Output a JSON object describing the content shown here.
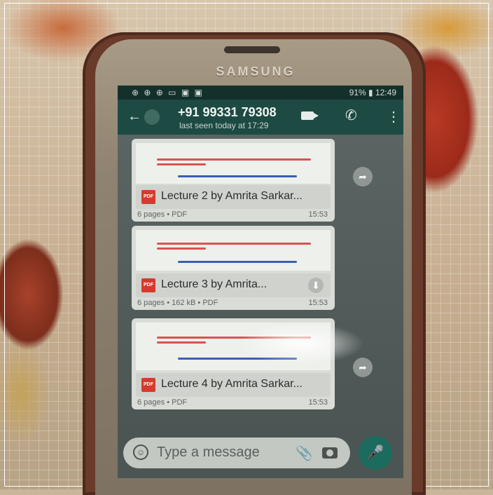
{
  "phone": {
    "brand": "SAMSUNG"
  },
  "status_bar": {
    "left_icons": "⊕ ⊕ ⊕ ▭ ▣ ▣",
    "right": "91% ▮ 12:49"
  },
  "header": {
    "contact": "+91 99331 79308",
    "last_seen": "last seen today at 17:29"
  },
  "messages": [
    {
      "title": "Lecture 2 by Amrita Sarkar...",
      "meta": "6 pages • PDF",
      "time": "15:53",
      "pdf_label": "PDF"
    },
    {
      "title": "Lecture 3 by Amrita...",
      "meta": "6 pages • 162 kB • PDF",
      "time": "15:53",
      "pdf_label": "PDF"
    },
    {
      "title": "Lecture 4 by Amrita Sarkar...",
      "meta": "6 pages • PDF",
      "time": "15:53",
      "pdf_label": "PDF"
    }
  ],
  "input": {
    "placeholder": "Type a message"
  },
  "icons": {
    "back": "back-arrow-icon",
    "video": "video-call-icon",
    "call": "phone-call-icon",
    "menu": "more-vert-icon",
    "emoji": "emoji-icon",
    "attach": "paperclip-icon",
    "camera": "camera-icon",
    "mic": "microphone-icon",
    "share": "forward-icon",
    "download": "download-icon"
  },
  "colors": {
    "header": "#1d4a42",
    "mic": "#1b6b5e",
    "pdf": "#d63a2e"
  }
}
